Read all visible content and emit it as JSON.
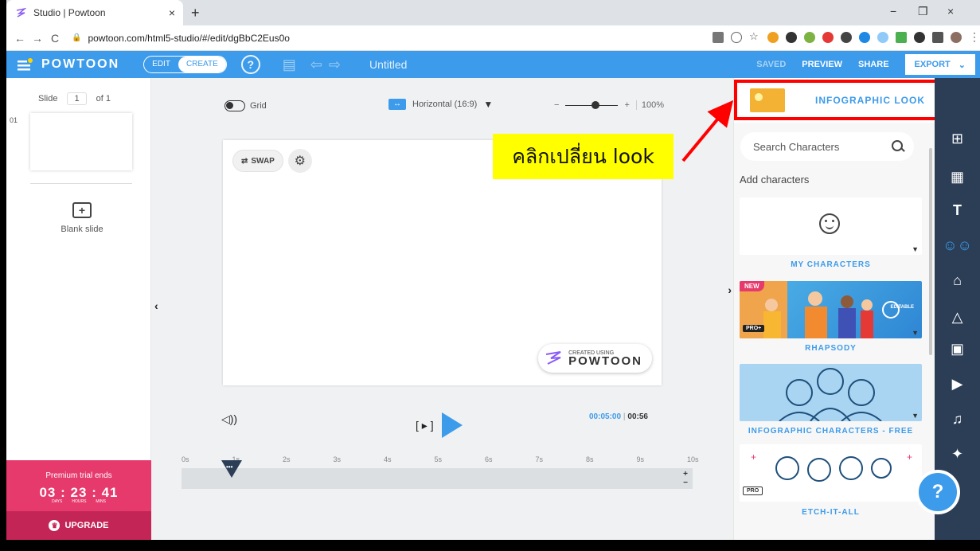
{
  "browser": {
    "tab_title": "Studio | Powtoon",
    "tab_close": "×",
    "new_tab": "+",
    "url": "powtoon.com/html5-studio/#/edit/dgBbC2Eus0o",
    "back": "←",
    "forward": "→",
    "reload": "C",
    "minimize": "−",
    "maximize": "❐",
    "close": "×"
  },
  "header": {
    "logo": "POWTOON",
    "mode_edit": "EDIT",
    "mode_create": "CREATE",
    "help_icon": "?",
    "title": "Untitled",
    "saved": "SAVED",
    "preview": "PREVIEW",
    "share": "SHARE",
    "export": "EXPORT",
    "export_caret": "⌄"
  },
  "slides": {
    "label": "Slide",
    "current": "1",
    "of": "of 1",
    "index": "01",
    "blank_label": "Blank slide",
    "blank_plus": "+"
  },
  "trial": {
    "title": "Premium trial ends",
    "days": "03",
    "hours": "23",
    "mins": "41",
    "sep": ":",
    "days_lbl": "DAYS",
    "hours_lbl": "HOURS",
    "mins_lbl": "MINS",
    "upgrade": "UPGRADE"
  },
  "toolbar": {
    "grid": "Grid",
    "orientation": "Horizontal (16:9)",
    "zoom_minus": "−",
    "zoom_plus": "+",
    "zoom_value": "100%",
    "zoom_level": 0.57
  },
  "canvas": {
    "swap": "SWAP",
    "badge_small": "CREATED USING",
    "badge_big": "POWTOON"
  },
  "callout": {
    "text": "คลิกเปลี่ยน look",
    "color": "#ffff00",
    "highlight_color": "#ff0000"
  },
  "player": {
    "current_time": "00:05:00",
    "total_time": "00:56",
    "frame_icon": "[ ▸ ]",
    "volume_icon": "◁))"
  },
  "timeline": {
    "ticks": [
      "0s",
      "1s",
      "2s",
      "3s",
      "4s",
      "5s",
      "6s",
      "7s",
      "8s",
      "9s",
      "10s"
    ],
    "zoom_in": "+",
    "zoom_out": "−",
    "playhead_dots": "•••"
  },
  "library": {
    "look_label": "INFOGRAPHIC LOOK",
    "look_caret": "▼",
    "search_placeholder": "Search Characters",
    "add_characters": "Add characters",
    "cards": [
      {
        "label": "MY CHARACTERS"
      },
      {
        "label": "RHAPSODY",
        "new_tag": "NEW",
        "pro_tag": "PRO+",
        "editable": "EDITABLE"
      },
      {
        "label": "INFOGRAPHIC CHARACTERS - FREE"
      },
      {
        "label": "ETCH-IT-ALL",
        "pro_tag": "PRO"
      }
    ],
    "card_caret": "▼"
  },
  "sidenav": {
    "items": [
      "layouts-icon",
      "backgrounds-icon",
      "text-icon",
      "characters-icon",
      "props-icon",
      "shapes-icon",
      "images-icon",
      "video-icon",
      "sound-icon",
      "specials-icon"
    ]
  },
  "help_button": "?",
  "colors": {
    "brand_blue": "#3c9bea",
    "sidenav_bg": "#2b3e56",
    "trial_pink": "#e6396c"
  }
}
